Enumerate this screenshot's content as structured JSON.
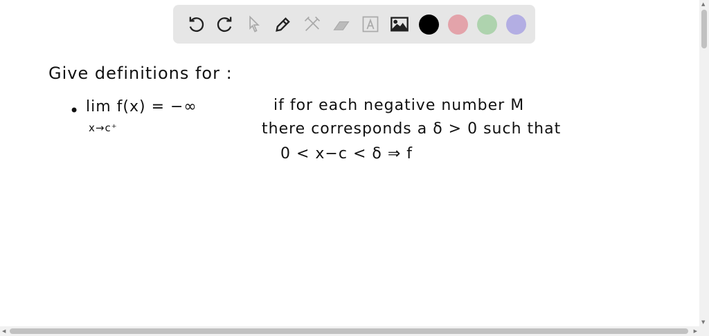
{
  "toolbar": {
    "tools": [
      "undo-icon",
      "redo-icon",
      "select-icon",
      "pen-icon",
      "tools-icon",
      "eraser-icon",
      "text-icon",
      "image-icon"
    ],
    "colors": [
      "#000000",
      "#e3a3aa",
      "#aed3ae",
      "#b3aee3"
    ]
  },
  "canvas": {
    "heading": "Give definitions for :",
    "bullet": "•",
    "limit": "lim f(x) =  −∞",
    "limit_sub": "x→c⁺",
    "line1": "if for each negative number M",
    "line2": "there corresponds a δ > 0   such that",
    "line3": "0  < x−c < δ  ⇒  f"
  }
}
